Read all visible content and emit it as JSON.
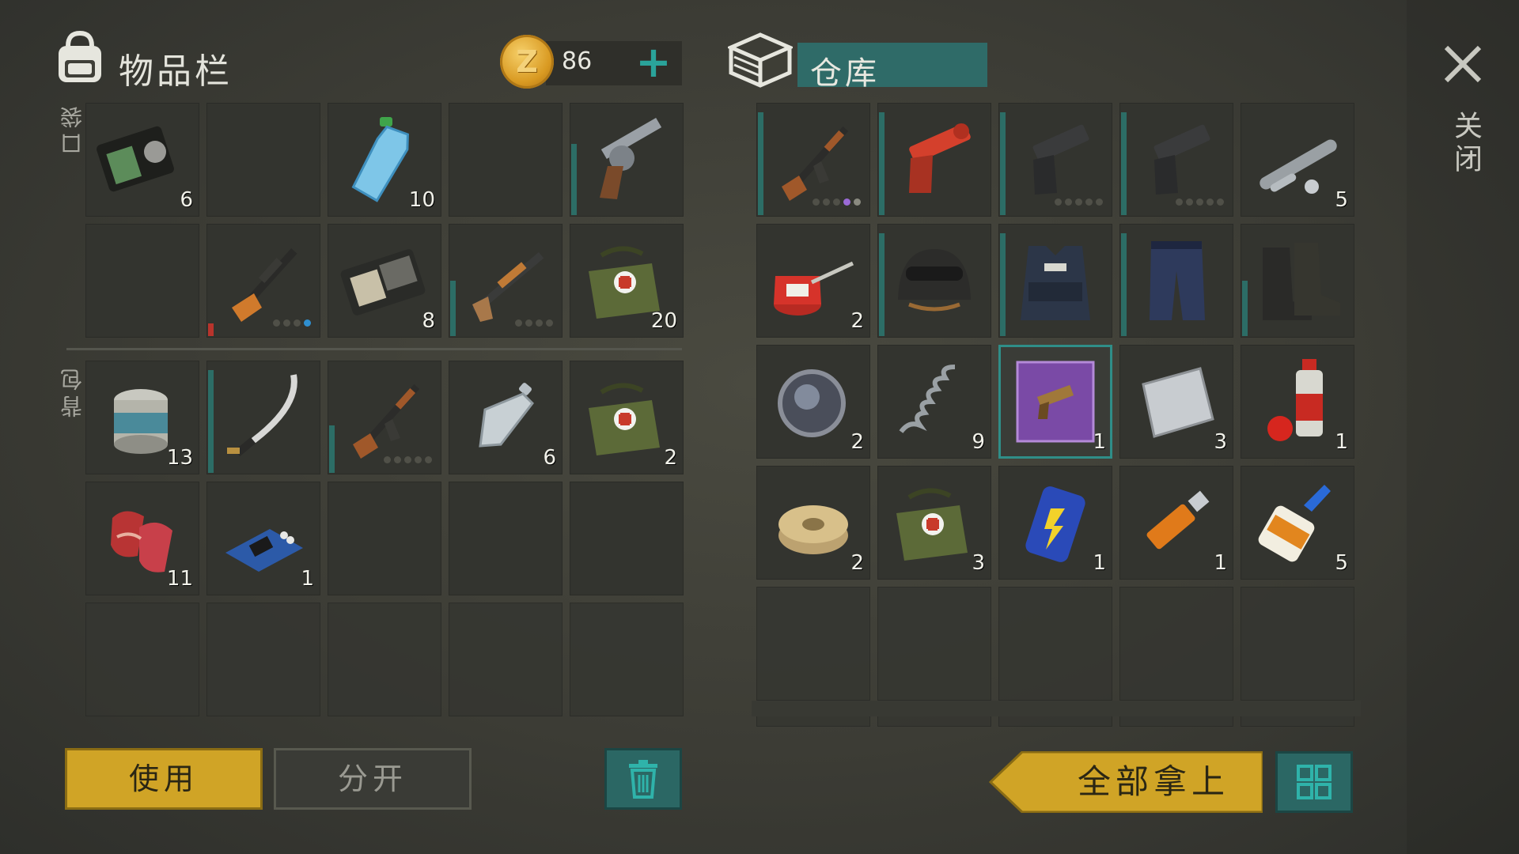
{
  "inventory": {
    "title": "物品栏",
    "coins": "86",
    "add_label": "+",
    "pocket_label": "口袋",
    "backpack_label": "背包",
    "pocket_slots": [
      {
        "icon": "police-badge-wallet-icon",
        "qty": "6"
      },
      {
        "icon": "",
        "qty": ""
      },
      {
        "icon": "water-bottle-icon",
        "qty": "10"
      },
      {
        "icon": "",
        "qty": ""
      },
      {
        "icon": "revolver-icon",
        "qty": ""
      },
      {
        "icon": "",
        "qty": ""
      },
      {
        "icon": "sniper-rifle-icon",
        "qty": ""
      },
      {
        "icon": "patrol-officer-wallet-icon",
        "qty": "8"
      },
      {
        "icon": "shotgun-icon",
        "qty": ""
      },
      {
        "icon": "medical-bag-icon",
        "qty": "20"
      }
    ],
    "backpack_slots": [
      {
        "icon": "canned-food-icon",
        "qty": "13"
      },
      {
        "icon": "katana-icon",
        "qty": ""
      },
      {
        "icon": "assault-rifle-icon",
        "qty": ""
      },
      {
        "icon": "empty-bottle-icon",
        "qty": "6"
      },
      {
        "icon": "medical-bag-icon",
        "qty": "2"
      },
      {
        "icon": "raw-meat-icon",
        "qty": "11"
      },
      {
        "icon": "circuit-board-icon",
        "qty": "1"
      },
      {
        "icon": "",
        "qty": ""
      },
      {
        "icon": "",
        "qty": ""
      },
      {
        "icon": "",
        "qty": ""
      }
    ]
  },
  "storage": {
    "title": "仓库",
    "slots": [
      {
        "icon": "assault-rifle-icon",
        "qty": ""
      },
      {
        "icon": "flare-gun-icon",
        "qty": ""
      },
      {
        "icon": "pistol-icon",
        "qty": ""
      },
      {
        "icon": "pistol-icon",
        "qty": ""
      },
      {
        "icon": "gun-parts-icon",
        "qty": "5"
      },
      {
        "icon": "oil-can-icon",
        "qty": "2"
      },
      {
        "icon": "tactical-helmet-icon",
        "qty": ""
      },
      {
        "icon": "police-vest-icon",
        "qty": ""
      },
      {
        "icon": "tactical-pants-icon",
        "qty": ""
      },
      {
        "icon": "boots-icon",
        "qty": ""
      },
      {
        "icon": "lens-icon",
        "qty": "2"
      },
      {
        "icon": "spring-icon",
        "qty": "9"
      },
      {
        "icon": "blueprint-icon",
        "qty": "1"
      },
      {
        "icon": "metal-sheet-icon",
        "qty": "3"
      },
      {
        "icon": "spray-paint-icon",
        "qty": "1"
      },
      {
        "icon": "wire-spool-icon",
        "qty": "2"
      },
      {
        "icon": "medical-bag-icon",
        "qty": "3"
      },
      {
        "icon": "energy-drink-icon",
        "qty": "1"
      },
      {
        "icon": "usb-drive-icon",
        "qty": "1"
      },
      {
        "icon": "super-glue-icon",
        "qty": "5"
      }
    ]
  },
  "close_label": "关闭",
  "buttons": {
    "use": "使用",
    "split": "分开",
    "take_all": "全部拿上",
    "trash_icon": "trash-icon",
    "sort_icon": "grid-icon"
  },
  "colors": {
    "accent_teal": "#2f6b68",
    "button_gold": "#d0a426",
    "durability_red": "#b8342c"
  }
}
